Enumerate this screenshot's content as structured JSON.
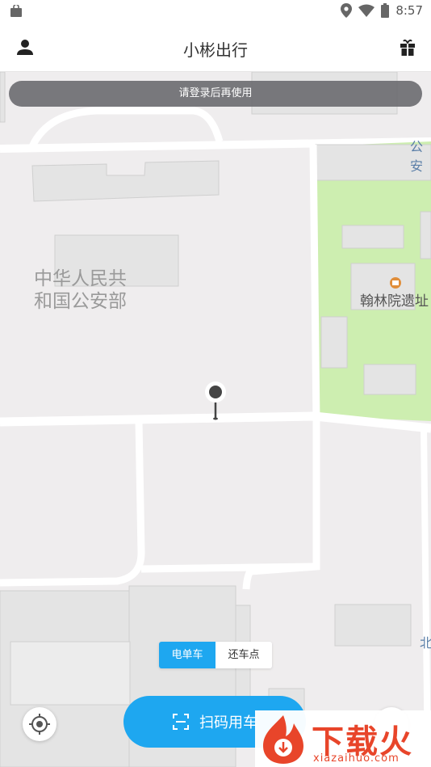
{
  "status_bar": {
    "time": "8:57"
  },
  "app_bar": {
    "title": "小彬出行"
  },
  "notice": {
    "text": "请登录后再使用"
  },
  "map": {
    "labels": {
      "ministry_line1": "中华人民共",
      "ministry_line2": "和国公安部",
      "hanlin": "翰林院遗址",
      "top_right": "公安",
      "right_edge": "北"
    }
  },
  "mode_toggle": {
    "active_label": "电单车",
    "inactive_label": "还车点"
  },
  "scan_button": {
    "label": "扫码用车"
  },
  "watermark": {
    "title": "下载火",
    "url": "xiazaihuo.com"
  },
  "colors": {
    "accent": "#1ea7f0",
    "park": "#cdeeb0",
    "watermark": "#e8452a"
  }
}
